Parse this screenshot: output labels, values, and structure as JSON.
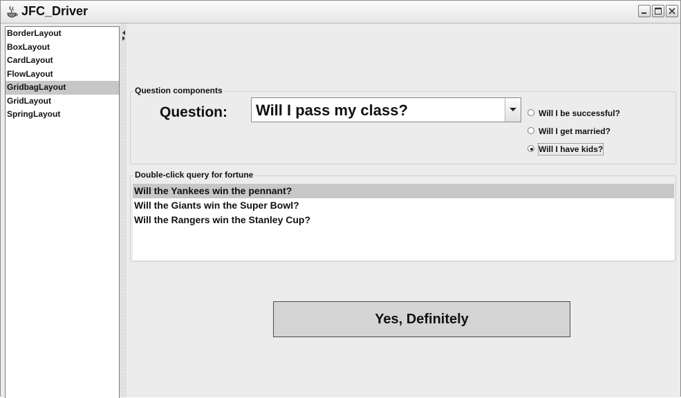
{
  "window": {
    "title": "JFC_Driver"
  },
  "sidebar": {
    "items": [
      {
        "label": "BorderLayout"
      },
      {
        "label": "BoxLayout"
      },
      {
        "label": "CardLayout"
      },
      {
        "label": "FlowLayout"
      },
      {
        "label": "GridbagLayout",
        "selected": true
      },
      {
        "label": "GridLayout"
      },
      {
        "label": "SpringLayout"
      }
    ]
  },
  "question_group": {
    "title": "Question components",
    "label": "Question:",
    "combo_value": "Will I pass my class?",
    "radios": [
      {
        "label": "Will I be successful?",
        "checked": false
      },
      {
        "label": "Will I get married?",
        "checked": false
      },
      {
        "label": "Will I have kids?",
        "checked": true
      }
    ]
  },
  "fortune_group": {
    "title": "Double-click query for fortune",
    "items": [
      {
        "label": "Will the Yankees win the pennant?",
        "selected": true
      },
      {
        "label": "Will the Giants win the Super Bowl?"
      },
      {
        "label": "Will the Rangers win the Stanley Cup?"
      }
    ]
  },
  "answer": {
    "text": "Yes, Definitely"
  },
  "icons": [
    "java-cup-icon",
    "minimize-icon",
    "maximize-icon",
    "close-icon",
    "chevron-down-icon",
    "arrow-left-icon",
    "arrow-right-icon"
  ]
}
